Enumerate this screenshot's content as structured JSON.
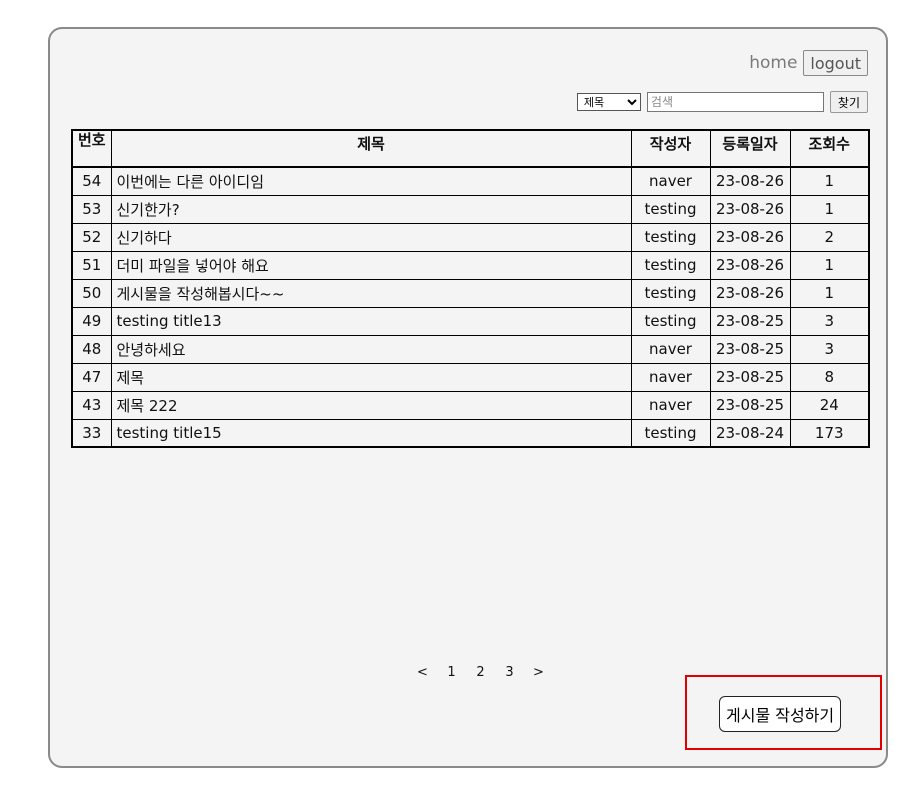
{
  "nav": {
    "home_label": "home",
    "logout_label": "logout"
  },
  "search": {
    "select_value": "제목",
    "placeholder": "검색",
    "button_label": "찾기"
  },
  "table": {
    "headers": [
      "번호",
      "제목",
      "작성자",
      "등록일자",
      "조회수"
    ],
    "rows": [
      {
        "num": "54",
        "title": "이번에는 다른 아이디임",
        "writer": "naver",
        "date": "23-08-26",
        "views": "1"
      },
      {
        "num": "53",
        "title": "신기한가?",
        "writer": "testing",
        "date": "23-08-26",
        "views": "1"
      },
      {
        "num": "52",
        "title": "신기하다",
        "writer": "testing",
        "date": "23-08-26",
        "views": "2"
      },
      {
        "num": "51",
        "title": "더미 파일을 넣어야 해요",
        "writer": "testing",
        "date": "23-08-26",
        "views": "1"
      },
      {
        "num": "50",
        "title": "게시물을 작성해봅시다~~",
        "writer": "testing",
        "date": "23-08-26",
        "views": "1"
      },
      {
        "num": "49",
        "title": "testing title13",
        "writer": "testing",
        "date": "23-08-25",
        "views": "3"
      },
      {
        "num": "48",
        "title": "안녕하세요",
        "writer": "naver",
        "date": "23-08-25",
        "views": "3"
      },
      {
        "num": "47",
        "title": "제목",
        "writer": "naver",
        "date": "23-08-25",
        "views": "8"
      },
      {
        "num": "43",
        "title": "제목 222",
        "writer": "naver",
        "date": "23-08-25",
        "views": "24"
      },
      {
        "num": "33",
        "title": "testing title15",
        "writer": "testing",
        "date": "23-08-24",
        "views": "173"
      }
    ]
  },
  "pagination": {
    "prev": "<",
    "pages": [
      "1",
      "2",
      "3"
    ],
    "next": ">"
  },
  "write_button_label": "게시물 작성하기",
  "colors": {
    "highlight": "#e00000",
    "panel_bg": "#f4f4f4"
  }
}
